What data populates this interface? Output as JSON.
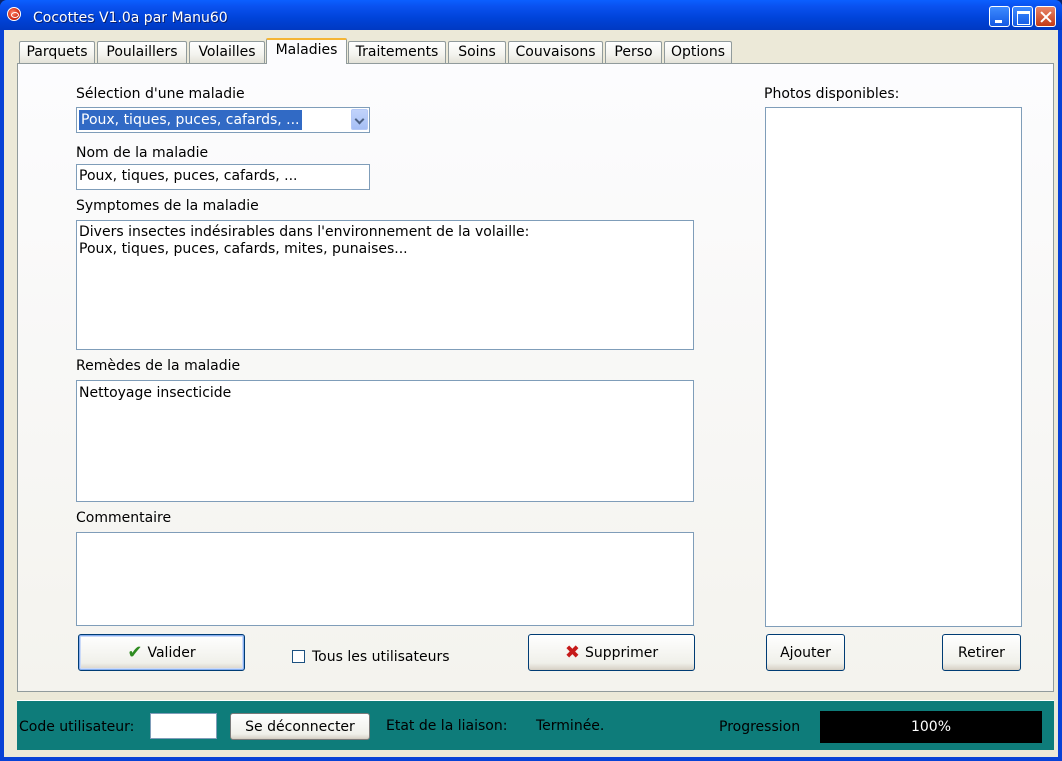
{
  "window": {
    "title": "Cocottes V1.0a par Manu60"
  },
  "tabs": [
    {
      "label": "Parquets"
    },
    {
      "label": "Poulaillers"
    },
    {
      "label": "Volailles"
    },
    {
      "label": "Maladies"
    },
    {
      "label": "Traitements"
    },
    {
      "label": "Soins"
    },
    {
      "label": "Couvaisons"
    },
    {
      "label": "Perso"
    },
    {
      "label": "Options"
    }
  ],
  "active_tab": "Maladies",
  "form": {
    "selection_label": "Sélection d'une maladie",
    "selection_value": "Poux, tiques, puces, cafards, ...",
    "name_label": "Nom de la maladie",
    "name_value": "Poux, tiques, puces, cafards, ...",
    "symptoms_label": "Symptomes de la maladie",
    "symptoms_value": "Divers insectes indésirables dans l'environnement de la volaille:\nPoux, tiques, puces, cafards, mites, punaises...",
    "remedies_label": "Remèdes de la maladie",
    "remedies_value": "Nettoyage insecticide",
    "comment_label": "Commentaire",
    "comment_value": "",
    "validate_label": "Valider",
    "all_users_label": "Tous les utilisateurs",
    "all_users_checked": false,
    "delete_label": "Supprimer"
  },
  "photos": {
    "label": "Photos disponibles:",
    "add_label": "Ajouter",
    "remove_label": "Retirer"
  },
  "status": {
    "user_code_label": "Code utilisateur:",
    "user_code_value": "",
    "disconnect_label": "Se déconnecter",
    "link_state_label": "Etat de la liaison:",
    "link_state_value": "Terminée.",
    "progress_label": "Progression",
    "progress_percent": 100,
    "progress_text": "100%"
  },
  "colors": {
    "titlebar": "#0043d9",
    "status_bar": "#0e7c7a",
    "selection_highlight": "#316ac5",
    "progress_bg": "#000000"
  }
}
